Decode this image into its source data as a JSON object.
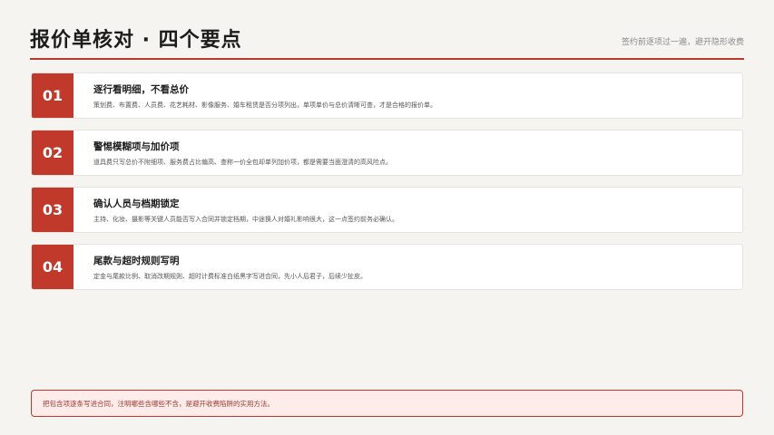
{
  "header": {
    "title": "报价单核对 · 四个要点",
    "subtitle": "签约前逐项过一遍，避开隐形收费"
  },
  "items": [
    {
      "num": "01",
      "title": "逐行看明细，不看总价",
      "desc": "策划费、布置费、人员费、花艺耗材、影像服务、婚车租赁是否分项列出，单项单价与总价清晰可查，才是合格的报价单。"
    },
    {
      "num": "02",
      "title": "警惕模糊项与加价项",
      "desc": "道具费只写总价不附细项、服务费占比偏高、查称一价全包却单列加价项，都是需要当面澄清的高风险点。"
    },
    {
      "num": "03",
      "title": "确认人员与档期锁定",
      "desc": "主持、化妆、摄影等关键人员能否写入合同并锁定档期，中途换人对婚礼影响很大，这一点签约前务必确认。"
    },
    {
      "num": "04",
      "title": "尾款与超时规则写明",
      "desc": "定金与尾款比例、取消改期规则、超时计费标准白纸黑字写进合同，先小人后君子，后续少扯皮。"
    }
  ],
  "note": {
    "text": "把包含项逐条写进合同，注明哪些含哪些不含，是避开收费陷阱的实用方法。"
  }
}
